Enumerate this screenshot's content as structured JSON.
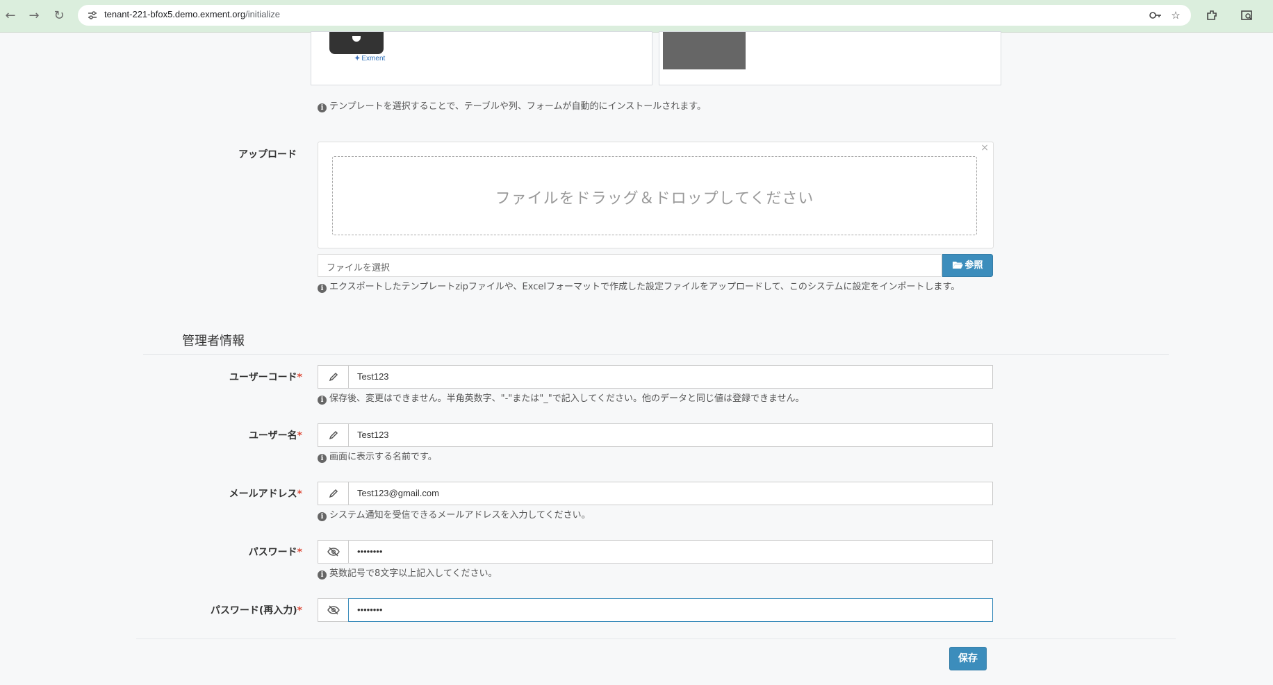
{
  "browser": {
    "url_host": "tenant-221-bfox5.demo.exment.org",
    "url_path": "/initialize"
  },
  "template_section": {
    "logo_text": "Exment",
    "help": "テンプレートを選択することで、テーブルや列、フォームが自動的にインストールされます。"
  },
  "upload": {
    "label": "アップロード",
    "dropzone_text": "ファイルをドラッグ＆ドロップしてください",
    "close_symbol": "×",
    "file_placeholder": "ファイルを選択",
    "browse_label": "参照",
    "help": "エクスポートしたテンプレートzipファイルや、Excelフォーマットで作成した設定ファイルをアップロードして、このシステムに設定をインポートします。"
  },
  "admin": {
    "section_title": "管理者情報",
    "required_mark": "*",
    "fields": [
      {
        "label": "ユーザーコード",
        "icon": "pencil-icon",
        "value": "Test123",
        "help": "保存後、変更はできません。半角英数字、\"-\"または\"_\"で記入してください。他のデータと同じ値は登録できません。"
      },
      {
        "label": "ユーザー名",
        "icon": "pencil-icon",
        "value": "Test123",
        "help": "画面に表示する名前です。"
      },
      {
        "label": "メールアドレス",
        "icon": "pencil-icon",
        "value": "Test123@gmail.com",
        "help": "システム通知を受信できるメールアドレスを入力してください。"
      },
      {
        "label": "パスワード",
        "icon": "eye-slash-icon",
        "value": "••••••••",
        "help": "英数記号で8文字以上記入してください。"
      },
      {
        "label": "パスワード(再入力)",
        "icon": "eye-slash-icon",
        "value": "••••••••",
        "help": ""
      }
    ]
  },
  "save_label": "保存",
  "colors": {
    "primary": "#3c8dbc",
    "required": "#dd4b39",
    "chrome": "#dbeedd"
  }
}
